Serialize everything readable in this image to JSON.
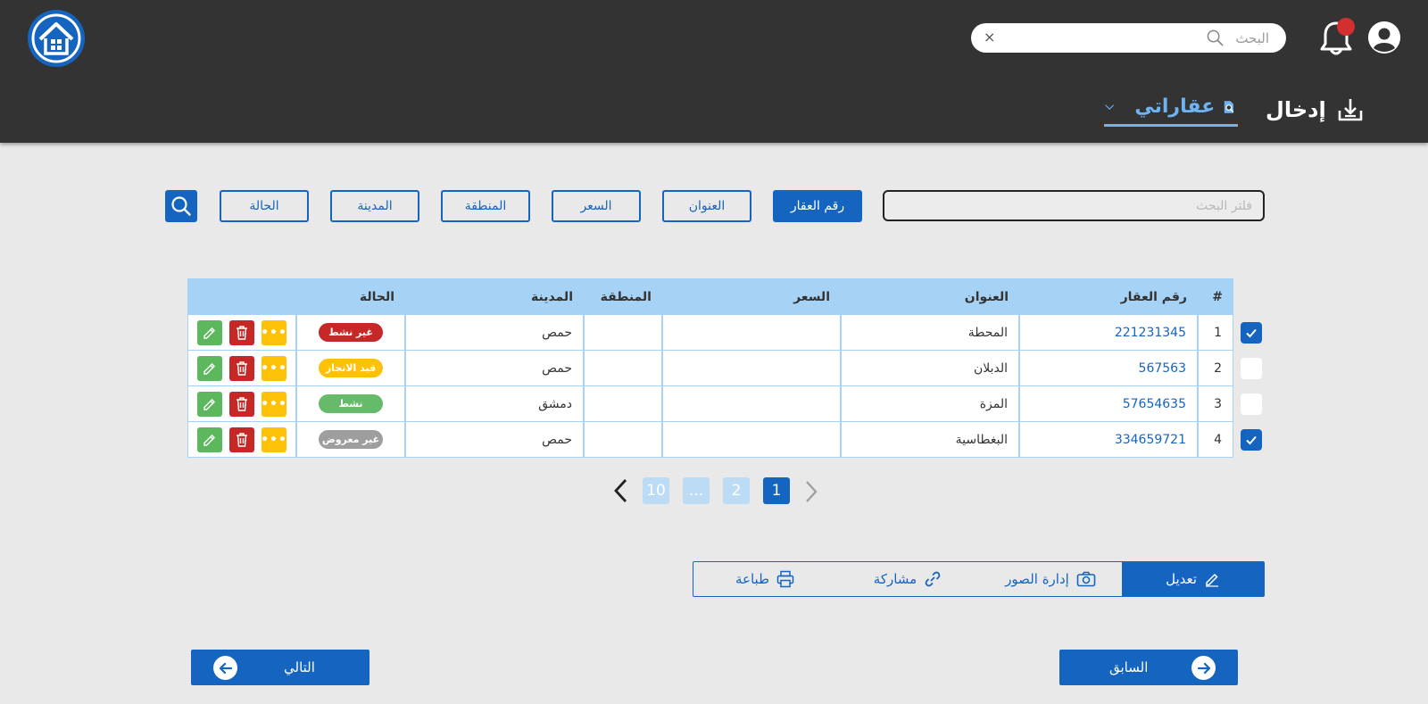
{
  "header": {
    "search_placeholder": "البحث",
    "clear_symbol": "×",
    "nav_import_label": "إدخال",
    "nav_my_properties_label": "عقاراتي"
  },
  "filters": {
    "search_placeholder": "فلتر البحث",
    "buttons": [
      "رقم العقار",
      "العنوان",
      "السعر",
      "المنطقة",
      "المدينة",
      "الحالة"
    ],
    "active_button": "رقم العقار"
  },
  "table": {
    "columns": {
      "index": "#",
      "id": "رقم العقار",
      "address": "العنوان",
      "price": "السعر",
      "region": "المنطقة",
      "city": "المدينة",
      "status": "الحالة"
    },
    "rows": [
      {
        "checked": true,
        "index": "1",
        "id": "221231345",
        "address": "المحطة",
        "price": "",
        "region": "",
        "city": "حمص",
        "status": "غير نشط",
        "status_color": "#c62828"
      },
      {
        "checked": false,
        "index": "2",
        "id": "567563",
        "address": "الدبلان",
        "price": "",
        "region": "",
        "city": "حمص",
        "status": "قيد الانجاز",
        "status_color": "#ffc107"
      },
      {
        "checked": false,
        "index": "3",
        "id": "57654635",
        "address": "المزة",
        "price": "",
        "region": "",
        "city": "دمشق",
        "status": "نشط",
        "status_color": "#66bb6a"
      },
      {
        "checked": true,
        "index": "4",
        "id": "334659721",
        "address": "البغطاسية",
        "price": "",
        "region": "",
        "city": "حمص",
        "status": "غير معروض",
        "status_color": "#9e9e9e"
      }
    ],
    "more_symbol": "•••"
  },
  "pagination": {
    "pages": [
      "1",
      "2",
      "...",
      "10"
    ],
    "current": "1"
  },
  "toolbar": {
    "edit": "تعديل",
    "photos": "إدارة الصور",
    "share": "مشاركة",
    "print": "طباعة"
  },
  "footer": {
    "previous": "السابق",
    "next": "التالي"
  },
  "colors": {
    "primary": "#1565c0",
    "header_bg": "#333333",
    "table_header": "#a6d3f5",
    "accent_light": "#6fb3f2"
  }
}
